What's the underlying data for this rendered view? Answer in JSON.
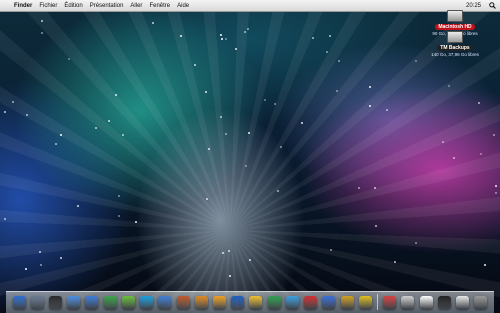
{
  "menubar": {
    "apple": "",
    "app_name": "Finder",
    "items": [
      "Fichier",
      "Édition",
      "Présentation",
      "Aller",
      "Fenêtre",
      "Aide"
    ],
    "clock": "20:25",
    "spotlight_icon": "search-icon"
  },
  "desktop": {
    "drives": [
      {
        "label": "Macintosh HD",
        "info": "90 Go, 56,69 Go libres",
        "style": "red"
      },
      {
        "label": "TM Backups",
        "info": "140 Go, 37,96 Go libres",
        "style": "dark"
      }
    ]
  },
  "dock": {
    "colors": [
      "#2f6fd0",
      "#6b7a90",
      "#2a2a2a",
      "#4a8fe0",
      "#3c7dd8",
      "#3ca54a",
      "#6bbf3a",
      "#1aa0e0",
      "#3e7fd6",
      "#c05a2a",
      "#e08a1e",
      "#f0a020",
      "#1e5fc0",
      "#f0c030",
      "#30a050",
      "#3aa0e0",
      "#d03030",
      "#3a6fd8",
      "#d0a020",
      "#e0c020",
      "#d84040",
      "#cfcfcf",
      "#ffffff",
      "#222222",
      "#e8e8e8",
      "#9a9a9a"
    ]
  }
}
